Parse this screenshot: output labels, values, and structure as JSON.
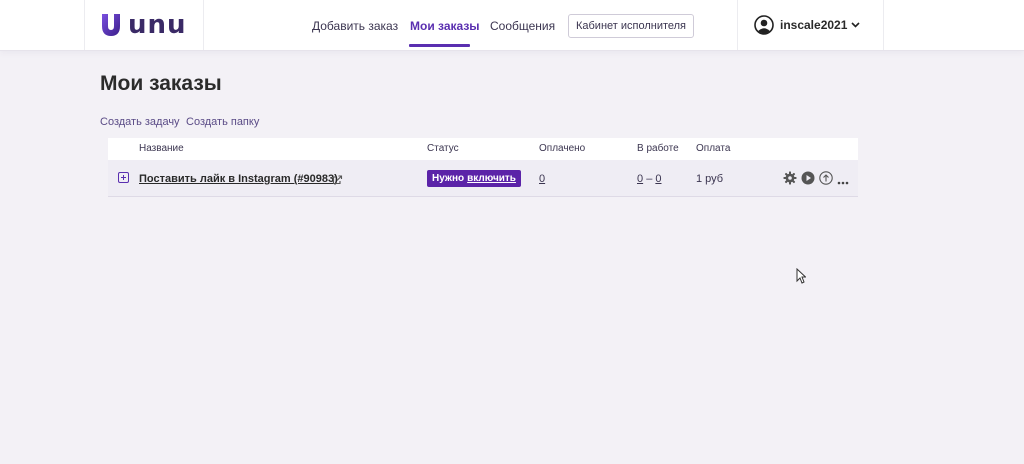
{
  "header": {
    "logo_text": "unu",
    "nav": {
      "add_order": "Добавить заказ",
      "my_orders": "Мои заказы",
      "messages": "Сообщения"
    },
    "executor_button": "Кабинет исполнителя",
    "username": "inscale2021"
  },
  "page": {
    "title": "Мои заказы",
    "actions": {
      "create_task": "Создать задачу",
      "create_folder": "Создать папку"
    }
  },
  "table": {
    "columns": {
      "name": "Название",
      "status": "Статус",
      "paid": "Оплачено",
      "in_work": "В работе",
      "payment": "Оплата"
    },
    "rows": [
      {
        "name": "Поставить лайк в Instagram (#90983)",
        "status_prefix": "Нужно",
        "status_link": "включить",
        "paid": "0",
        "in_work_from": "0",
        "in_work_dash": "–",
        "in_work_to": "0",
        "payment": "1 руб"
      }
    ]
  },
  "colors": {
    "accent": "#5a2fb0",
    "status_bg": "#5b23a8",
    "background": "#f3f1f6"
  },
  "icons": [
    "ext-link-icon",
    "gear-icon",
    "play-icon",
    "upload-icon",
    "more-icon",
    "user-icon",
    "chevron-down-icon",
    "expand-plus-icon",
    "cursor-icon"
  ]
}
